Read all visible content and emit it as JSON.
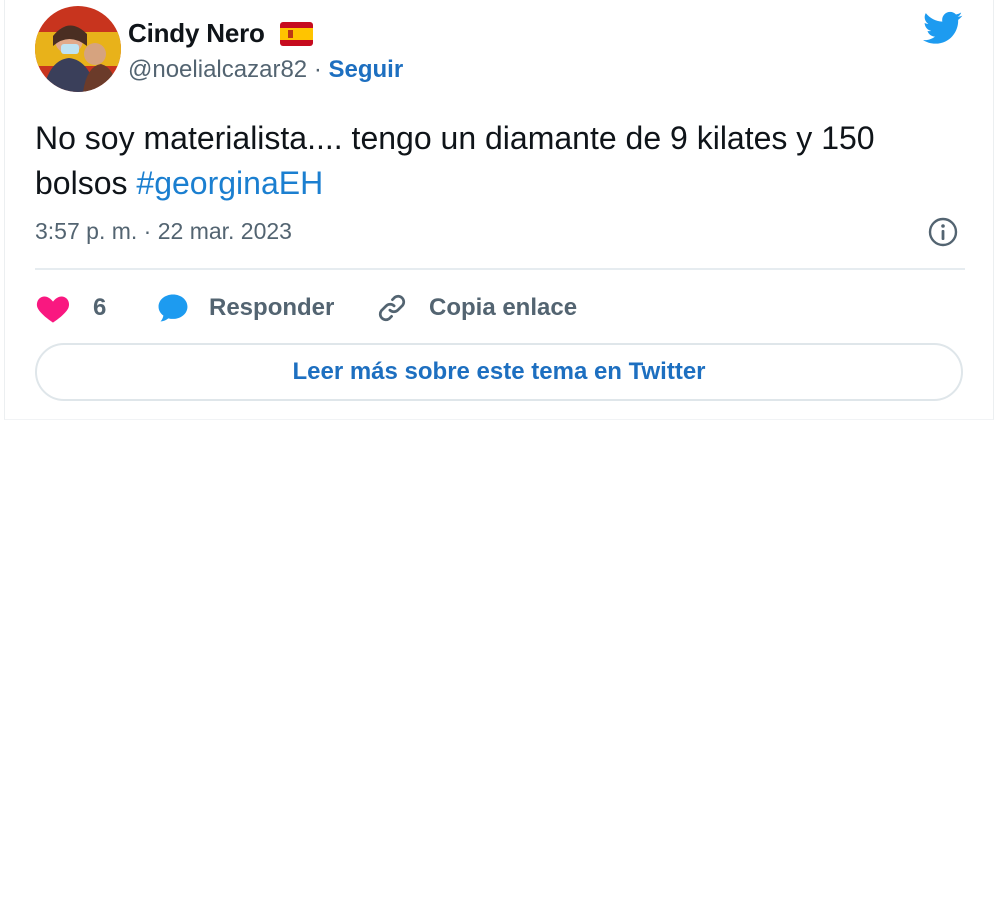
{
  "author": {
    "display_name": "Cindy Nero",
    "handle": "@noelialcazar82",
    "separator": "·",
    "follow_label": "Seguir"
  },
  "tweet": {
    "text": "No soy materialista.... tengo un diamante de 9 kilates y 150 bolsos",
    "hashtag": "#georginaEH",
    "timestamp": "3:57 p. m. · 22 mar. 2023"
  },
  "actions": {
    "like_count": "6",
    "reply_label": "Responder",
    "copy_label": "Copia enlace"
  },
  "read_more_label": "Leer más sobre este tema en Twitter",
  "colors": {
    "twitter_blue": "#1d9bf0",
    "link_blue": "#1d6fc0",
    "heart": "#f91880",
    "text": "#0f1419",
    "secondary": "#536471"
  },
  "icons": {
    "brand": "twitter-bird-icon",
    "flag": "spain-flag-icon",
    "info": "info-icon",
    "like": "heart-icon",
    "reply": "speech-bubble-icon",
    "copy": "link-icon"
  }
}
